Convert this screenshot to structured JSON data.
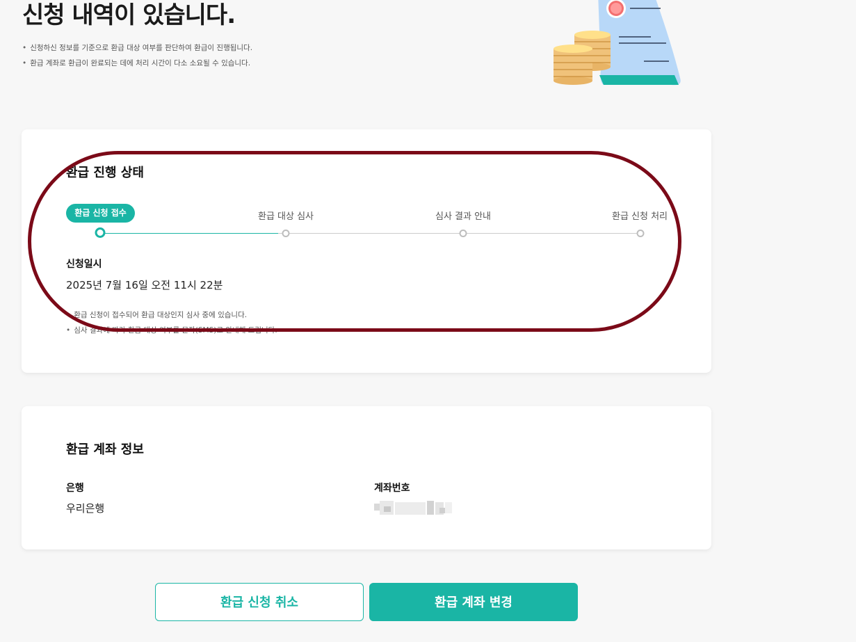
{
  "header": {
    "title": "신청 내역이 있습니다.",
    "notes": [
      "신청하신 정보를 기준으로 환급 대상 여부를 판단하여 환급이 진행됩니다.",
      "환급 계좌로 환급이 완료되는 데에 처리 시간이 다소 소요될 수 있습니다."
    ]
  },
  "status_card": {
    "title": "환급 진행 상태",
    "steps": [
      {
        "label": "환급 신청 접수",
        "active": true
      },
      {
        "label": "환급 대상 심사",
        "active": false
      },
      {
        "label": "심사 결과 안내",
        "active": false
      },
      {
        "label": "환급 신청 처리",
        "active": false
      }
    ],
    "progress": 0.33,
    "applied_at_label": "신청일시",
    "applied_at_value": "2025년 7월 16일 오전 11시 22분",
    "notes": [
      "환급 신청이 접수되어 환급 대상인지 심사 중에 있습니다.",
      "심사 결과에 따라 환급 대상 여부를 문자(SMS)로 안내해 드립니다."
    ]
  },
  "account_card": {
    "title": "환급 계좌 정보",
    "bank_label": "은행",
    "bank_value": "우리은행",
    "account_label": "계좌번호"
  },
  "buttons": {
    "cancel": "환급 신청 취소",
    "change_account": "환급 계좌 변경"
  },
  "colors": {
    "accent": "#1ab5a5",
    "highlight": "#7b0a18",
    "background": "#f7f7f7"
  }
}
